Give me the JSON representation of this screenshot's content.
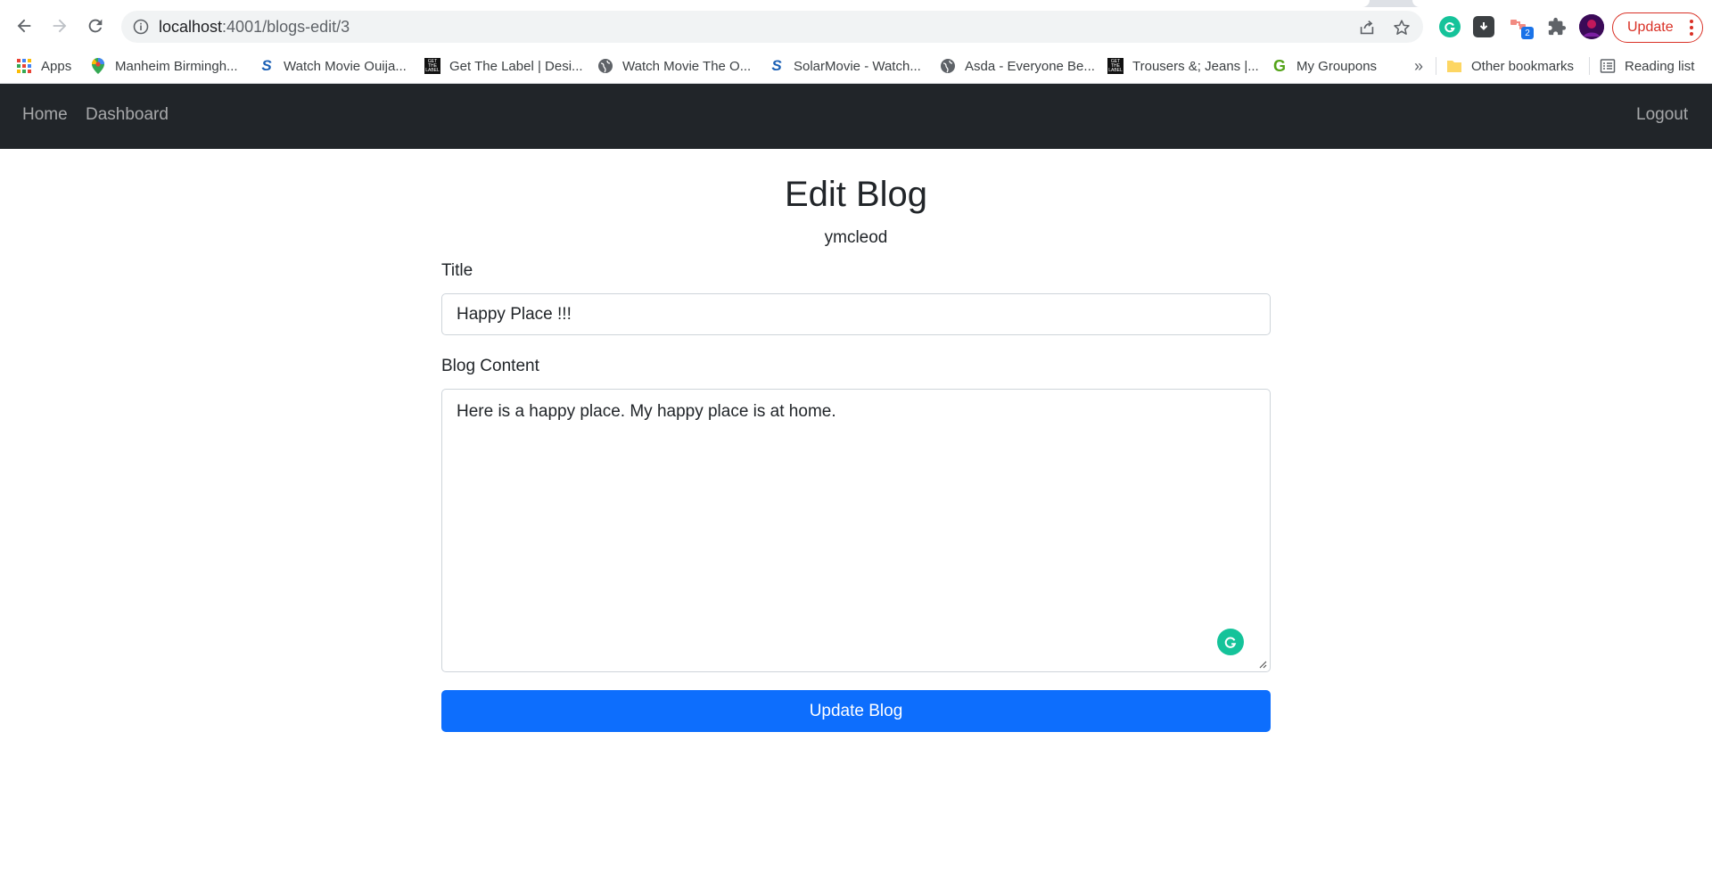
{
  "browser": {
    "url_host": "localhost",
    "url_path": ":4001/blogs-edit/3",
    "update_label": "Update",
    "bookmarks": [
      {
        "label": "Apps",
        "icon": "apps-grid-icon"
      },
      {
        "label": "Manheim Birmingh...",
        "icon": "maps-pin-icon"
      },
      {
        "label": "Watch Movie Ouija...",
        "icon": "solarmovie-icon"
      },
      {
        "label": "Get The Label | Desi...",
        "icon": "get-the-label-icon"
      },
      {
        "label": "Watch Movie The O...",
        "icon": "globe-icon"
      },
      {
        "label": "SolarMovie - Watch...",
        "icon": "solarmovie-icon"
      },
      {
        "label": "Asda - Everyone Be...",
        "icon": "globe-icon"
      },
      {
        "label": "Trousers &; Jeans |...",
        "icon": "get-the-label-icon"
      },
      {
        "label": "My Groupons",
        "icon": "groupon-icon"
      }
    ],
    "overflow_label": "»",
    "other_bookmarks": "Other bookmarks",
    "reading_list": "Reading list",
    "extension_badge": "2"
  },
  "navbar": {
    "home": "Home",
    "dashboard": "Dashboard",
    "logout": "Logout"
  },
  "form": {
    "heading": "Edit Blog",
    "author": "ymcleod",
    "title_label": "Title",
    "title_value": "Happy Place !!!",
    "content_label": "Blog Content",
    "content_value": "Here is a happy place. My happy place is at home.",
    "submit_label": "Update Blog"
  },
  "colors": {
    "navbar_bg": "#212529",
    "primary": "#0d6efd",
    "update_red": "#d93025",
    "grammarly_green": "#15c39a"
  }
}
